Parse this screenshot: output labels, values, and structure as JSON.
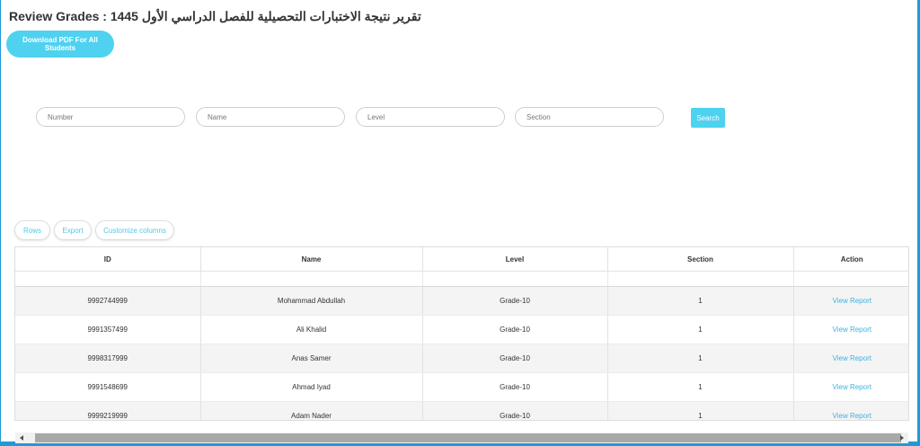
{
  "header": {
    "title": "Review Grades : 1445 تقرير نتيجة الاختبارات التحصيلية للفصل الدراسي الأول",
    "download_label": "Download PDF For All Students"
  },
  "filters": {
    "number_placeholder": "Number",
    "name_placeholder": "Name",
    "level_placeholder": "Level",
    "section_placeholder": "Section",
    "search_label": "Search"
  },
  "toolbar": {
    "rows_label": "Rows",
    "export_label": "Export",
    "customize_label": "Customize columns"
  },
  "table": {
    "columns": [
      "ID",
      "Name",
      "Level",
      "Section",
      "Action"
    ],
    "rows": [
      {
        "id": "9992744999",
        "name": "Mohammad Abdullah",
        "level": "Grade-10",
        "section": "1",
        "action": "View Report"
      },
      {
        "id": "9991357499",
        "name": "Ali Khalid",
        "level": "Grade-10",
        "section": "1",
        "action": "View Report"
      },
      {
        "id": "9998317999",
        "name": "Anas Samer",
        "level": "Grade-10",
        "section": "1",
        "action": "View Report"
      },
      {
        "id": "9991548699",
        "name": "Ahmad Iyad",
        "level": "Grade-10",
        "section": "1",
        "action": "View Report"
      },
      {
        "id": "9999219999",
        "name": "Adam Nader",
        "level": "Grade-10",
        "section": "1",
        "action": "View Report"
      }
    ]
  },
  "colors": {
    "accent": "#4fd2f0",
    "link": "#3db3e0",
    "frame": "#1e9ad6"
  }
}
